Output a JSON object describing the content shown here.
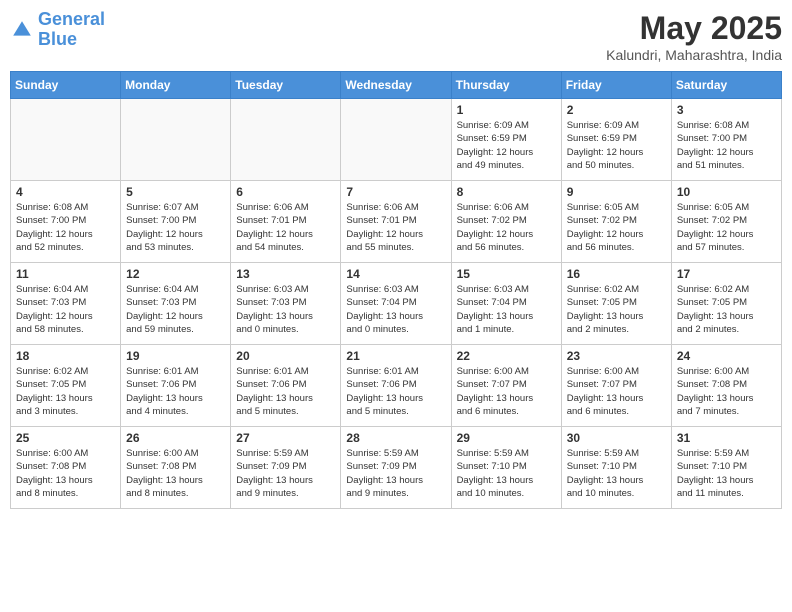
{
  "header": {
    "logo_line1": "General",
    "logo_line2": "Blue",
    "month_title": "May 2025",
    "location": "Kalundri, Maharashtra, India"
  },
  "weekdays": [
    "Sunday",
    "Monday",
    "Tuesday",
    "Wednesday",
    "Thursday",
    "Friday",
    "Saturday"
  ],
  "weeks": [
    [
      {
        "day": "",
        "info": ""
      },
      {
        "day": "",
        "info": ""
      },
      {
        "day": "",
        "info": ""
      },
      {
        "day": "",
        "info": ""
      },
      {
        "day": "1",
        "info": "Sunrise: 6:09 AM\nSunset: 6:59 PM\nDaylight: 12 hours\nand 49 minutes."
      },
      {
        "day": "2",
        "info": "Sunrise: 6:09 AM\nSunset: 6:59 PM\nDaylight: 12 hours\nand 50 minutes."
      },
      {
        "day": "3",
        "info": "Sunrise: 6:08 AM\nSunset: 7:00 PM\nDaylight: 12 hours\nand 51 minutes."
      }
    ],
    [
      {
        "day": "4",
        "info": "Sunrise: 6:08 AM\nSunset: 7:00 PM\nDaylight: 12 hours\nand 52 minutes."
      },
      {
        "day": "5",
        "info": "Sunrise: 6:07 AM\nSunset: 7:00 PM\nDaylight: 12 hours\nand 53 minutes."
      },
      {
        "day": "6",
        "info": "Sunrise: 6:06 AM\nSunset: 7:01 PM\nDaylight: 12 hours\nand 54 minutes."
      },
      {
        "day": "7",
        "info": "Sunrise: 6:06 AM\nSunset: 7:01 PM\nDaylight: 12 hours\nand 55 minutes."
      },
      {
        "day": "8",
        "info": "Sunrise: 6:06 AM\nSunset: 7:02 PM\nDaylight: 12 hours\nand 56 minutes."
      },
      {
        "day": "9",
        "info": "Sunrise: 6:05 AM\nSunset: 7:02 PM\nDaylight: 12 hours\nand 56 minutes."
      },
      {
        "day": "10",
        "info": "Sunrise: 6:05 AM\nSunset: 7:02 PM\nDaylight: 12 hours\nand 57 minutes."
      }
    ],
    [
      {
        "day": "11",
        "info": "Sunrise: 6:04 AM\nSunset: 7:03 PM\nDaylight: 12 hours\nand 58 minutes."
      },
      {
        "day": "12",
        "info": "Sunrise: 6:04 AM\nSunset: 7:03 PM\nDaylight: 12 hours\nand 59 minutes."
      },
      {
        "day": "13",
        "info": "Sunrise: 6:03 AM\nSunset: 7:03 PM\nDaylight: 13 hours\nand 0 minutes."
      },
      {
        "day": "14",
        "info": "Sunrise: 6:03 AM\nSunset: 7:04 PM\nDaylight: 13 hours\nand 0 minutes."
      },
      {
        "day": "15",
        "info": "Sunrise: 6:03 AM\nSunset: 7:04 PM\nDaylight: 13 hours\nand 1 minute."
      },
      {
        "day": "16",
        "info": "Sunrise: 6:02 AM\nSunset: 7:05 PM\nDaylight: 13 hours\nand 2 minutes."
      },
      {
        "day": "17",
        "info": "Sunrise: 6:02 AM\nSunset: 7:05 PM\nDaylight: 13 hours\nand 2 minutes."
      }
    ],
    [
      {
        "day": "18",
        "info": "Sunrise: 6:02 AM\nSunset: 7:05 PM\nDaylight: 13 hours\nand 3 minutes."
      },
      {
        "day": "19",
        "info": "Sunrise: 6:01 AM\nSunset: 7:06 PM\nDaylight: 13 hours\nand 4 minutes."
      },
      {
        "day": "20",
        "info": "Sunrise: 6:01 AM\nSunset: 7:06 PM\nDaylight: 13 hours\nand 5 minutes."
      },
      {
        "day": "21",
        "info": "Sunrise: 6:01 AM\nSunset: 7:06 PM\nDaylight: 13 hours\nand 5 minutes."
      },
      {
        "day": "22",
        "info": "Sunrise: 6:00 AM\nSunset: 7:07 PM\nDaylight: 13 hours\nand 6 minutes."
      },
      {
        "day": "23",
        "info": "Sunrise: 6:00 AM\nSunset: 7:07 PM\nDaylight: 13 hours\nand 6 minutes."
      },
      {
        "day": "24",
        "info": "Sunrise: 6:00 AM\nSunset: 7:08 PM\nDaylight: 13 hours\nand 7 minutes."
      }
    ],
    [
      {
        "day": "25",
        "info": "Sunrise: 6:00 AM\nSunset: 7:08 PM\nDaylight: 13 hours\nand 8 minutes."
      },
      {
        "day": "26",
        "info": "Sunrise: 6:00 AM\nSunset: 7:08 PM\nDaylight: 13 hours\nand 8 minutes."
      },
      {
        "day": "27",
        "info": "Sunrise: 5:59 AM\nSunset: 7:09 PM\nDaylight: 13 hours\nand 9 minutes."
      },
      {
        "day": "28",
        "info": "Sunrise: 5:59 AM\nSunset: 7:09 PM\nDaylight: 13 hours\nand 9 minutes."
      },
      {
        "day": "29",
        "info": "Sunrise: 5:59 AM\nSunset: 7:10 PM\nDaylight: 13 hours\nand 10 minutes."
      },
      {
        "day": "30",
        "info": "Sunrise: 5:59 AM\nSunset: 7:10 PM\nDaylight: 13 hours\nand 10 minutes."
      },
      {
        "day": "31",
        "info": "Sunrise: 5:59 AM\nSunset: 7:10 PM\nDaylight: 13 hours\nand 11 minutes."
      }
    ]
  ]
}
